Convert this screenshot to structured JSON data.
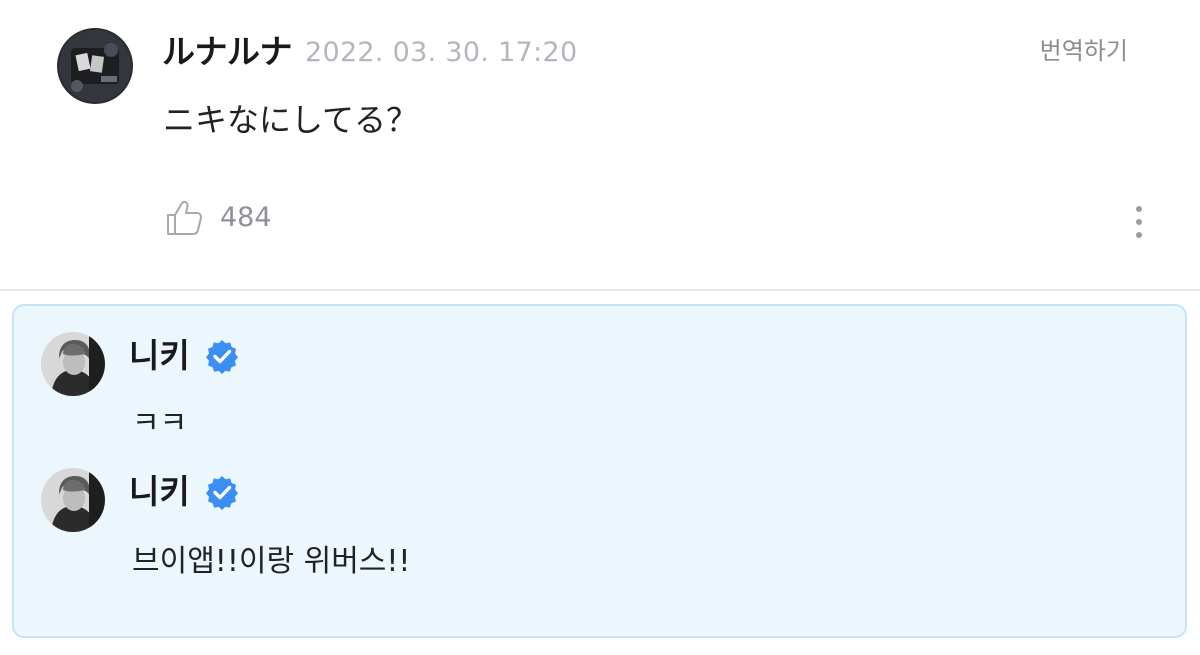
{
  "post": {
    "author": "ルナルナ",
    "timestamp": "2022. 03. 30. 17:20",
    "translate_label": "번역하기",
    "body": "ニキなにしてる？",
    "like_count": "484",
    "icons": {
      "like": "thumbs-up-icon",
      "more": "more-vertical-icon"
    }
  },
  "replies": [
    {
      "author": "니키",
      "verified": true,
      "text": "ㅋㅋ"
    },
    {
      "author": "니키",
      "verified": true,
      "text": "브이앱!!이랑 위버스!!"
    }
  ],
  "colors": {
    "reply_background": "#ebf6fd",
    "reply_border": "#c8e3f3",
    "verified_badge": "#3b8ff0",
    "muted_text": "#b3b6bd"
  }
}
